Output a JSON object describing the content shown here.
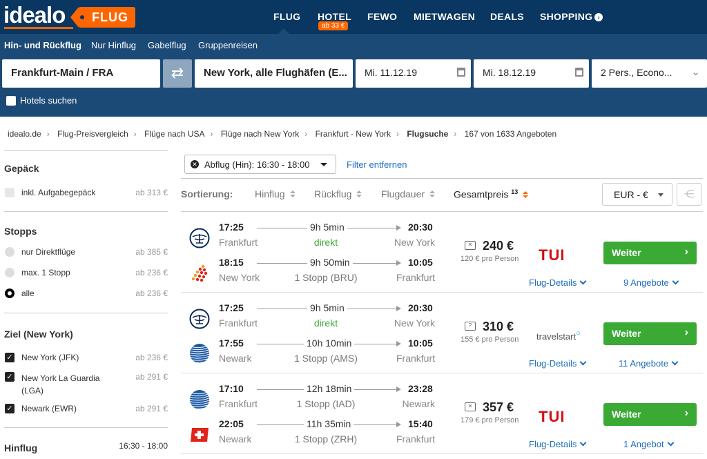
{
  "header": {
    "logo": "idealo",
    "product_tag": "FLUG",
    "nav": [
      {
        "label": "FLUG"
      },
      {
        "label": "HOTEL",
        "badge": "ab 33 €"
      },
      {
        "label": "FEWO"
      },
      {
        "label": "MIETWAGEN"
      },
      {
        "label": "DEALS"
      },
      {
        "label": "SHOPPING"
      }
    ]
  },
  "search": {
    "trip_types": [
      "Hin- und Rückflug",
      "Nur Hinflug",
      "Gabelflug",
      "Gruppenreisen"
    ],
    "origin": "Frankfurt-Main / FRA",
    "destination": "New York, alle Flughäfen (E...",
    "depart_date": "Mi. 11.12.19",
    "return_date": "Mi. 18.12.19",
    "passengers": "2 Pers., Econo...",
    "hotels_label": "Hotels suchen"
  },
  "breadcrumb": [
    "idealo.de",
    "Flug-Preisvergleich",
    "Flüge nach USA",
    "Flüge nach New York",
    "Frankfurt - New York",
    "Flugsuche"
  ],
  "result_count": "167 von 1633 Angeboten",
  "sidebar": {
    "gepaeck": {
      "title": "Gepäck",
      "items": [
        {
          "label": "inkl. Aufgabegepäck",
          "price": "ab 313 €"
        }
      ]
    },
    "stopps": {
      "title": "Stopps",
      "items": [
        {
          "label": "nur Direktflüge",
          "price": "ab 385 €"
        },
        {
          "label": "max. 1 Stopp",
          "price": "ab 236 €"
        },
        {
          "label": "alle",
          "price": "ab 236 €"
        }
      ]
    },
    "ziel": {
      "title": "Ziel (New York)",
      "items": [
        {
          "label": "New York (JFK)",
          "price": "ab 236 €"
        },
        {
          "label_1": "New York La Guardia",
          "label_2": "(LGA)",
          "price": "ab 291 €"
        },
        {
          "label": "Newark (EWR)",
          "price": "ab 291 €"
        }
      ]
    },
    "hinflug": {
      "title": "Hinflug",
      "range": "16:30 - 18:00"
    }
  },
  "filter": {
    "chip": "Abflug (Hin): 16:30 - 18:00",
    "remove": "Filter entfernen"
  },
  "sort": {
    "label": "Sortierung:",
    "options": [
      "Hinflug",
      "Rückflug",
      "Flugdauer"
    ],
    "active": "Gesamtpreis",
    "active_sup": "13",
    "currency": "EUR - €"
  },
  "results": [
    {
      "out": {
        "dep": "17:25",
        "dur": "9h 5min",
        "arr": "20:30",
        "from": "Frankfurt",
        "stops": "direkt",
        "to": "New York"
      },
      "ret": {
        "dep": "18:15",
        "dur": "9h 50min",
        "arr": "10:05",
        "from": "New York",
        "stops": "1 Stopp (BRU)",
        "to": "Frankfurt"
      },
      "price": "240 €",
      "per_person": "120 € pro Person",
      "provider": "TUI",
      "button": "Weiter",
      "details": "Flug-Details",
      "offers": "9 Angebote"
    },
    {
      "out": {
        "dep": "17:25",
        "dur": "9h 5min",
        "arr": "20:30",
        "from": "Frankfurt",
        "stops": "direkt",
        "to": "New York"
      },
      "ret": {
        "dep": "17:55",
        "dur": "10h 10min",
        "arr": "10:05",
        "from": "Newark",
        "stops": "1 Stopp (AMS)",
        "to": "Frankfurt"
      },
      "price": "310 €",
      "per_person": "155 € pro Person",
      "provider": "travelstart",
      "button": "Weiter",
      "details": "Flug-Details",
      "offers": "11 Angebote"
    },
    {
      "out": {
        "dep": "17:10",
        "dur": "12h 18min",
        "arr": "23:28",
        "from": "Frankfurt",
        "stops": "1 Stopp (IAD)",
        "to": "Newark"
      },
      "ret": {
        "dep": "22:05",
        "dur": "11h 35min",
        "arr": "15:40",
        "from": "Newark",
        "stops": "1 Stopp (ZRH)",
        "to": "Frankfurt"
      },
      "price": "357 €",
      "per_person": "179 € pro Person",
      "provider": "TUI",
      "button": "Weiter",
      "details": "Flug-Details",
      "offers": "1 Angebot"
    }
  ],
  "colors": {
    "header_bg": "#0a3761",
    "search_bg": "#1c4a76",
    "accent": "#ff6600",
    "cta": "#3aaa35",
    "link": "#1f6ebd",
    "direct": "#3aaa35"
  }
}
